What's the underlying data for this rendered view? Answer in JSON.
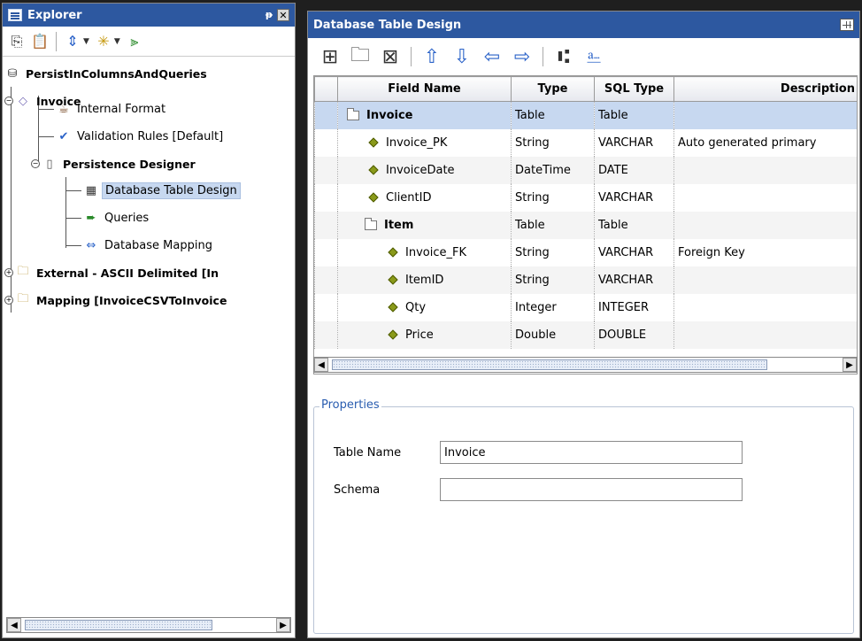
{
  "explorer": {
    "title": "Explorer",
    "pin": "ᵽ",
    "close": "✕",
    "toolbar": {
      "icons": [
        "copy-icon",
        "paste-icon",
        "sync-icon",
        "new-item-icon",
        "run-icon"
      ]
    },
    "tree": [
      {
        "label": "PersistInColumnsAndQueries",
        "icon": "database-icon"
      },
      {
        "label": "Invoice",
        "icon": "diamond-icon"
      },
      {
        "label": "Internal Format",
        "icon": "beans-icon"
      },
      {
        "label": "Validation Rules [Default]",
        "icon": "check-circle-icon"
      },
      {
        "label": "Persistence Designer",
        "icon": "cylinder-icon"
      },
      {
        "label": "Database Table Design",
        "icon": "table-icon"
      },
      {
        "label": "Queries",
        "icon": "query-arrow-icon"
      },
      {
        "label": "Database Mapping",
        "icon": "mapping-icon"
      },
      {
        "label": "External - ASCII Delimited [In",
        "icon": "folder-gear-icon"
      },
      {
        "label": "Mapping [InvoiceCSVToInvoice",
        "icon": "folder-gear-icon"
      }
    ]
  },
  "designer": {
    "title": "Database Table Design",
    "toolbar": {
      "icons": [
        "add-table-icon",
        "add-folder-icon",
        "delete-icon",
        "move-up-icon",
        "move-down-icon",
        "move-left-icon",
        "move-right-icon",
        "tree-icon",
        "import-icon"
      ]
    },
    "table": {
      "columns": [
        "Field Name",
        "Type",
        "SQL Type",
        "Description"
      ],
      "rows": [
        {
          "name": "Invoice",
          "type": "Table",
          "sql": "Table",
          "desc": ""
        },
        {
          "name": "Invoice_PK",
          "type": "String",
          "sql": "VARCHAR",
          "desc": "Auto generated primary"
        },
        {
          "name": "InvoiceDate",
          "type": "DateTime",
          "sql": "DATE",
          "desc": ""
        },
        {
          "name": "ClientID",
          "type": "String",
          "sql": "VARCHAR",
          "desc": ""
        },
        {
          "name": "Item",
          "type": "Table",
          "sql": "Table",
          "desc": ""
        },
        {
          "name": "Invoice_FK",
          "type": "String",
          "sql": "VARCHAR",
          "desc": "Foreign Key"
        },
        {
          "name": "ItemID",
          "type": "String",
          "sql": "VARCHAR",
          "desc": ""
        },
        {
          "name": "Qty",
          "type": "Integer",
          "sql": "INTEGER",
          "desc": ""
        },
        {
          "name": "Price",
          "type": "Double",
          "sql": "DOUBLE",
          "desc": ""
        }
      ]
    },
    "properties": {
      "legend": "Properties",
      "table_name_label": "Table Name",
      "table_name_value": "Invoice",
      "schema_label": "Schema",
      "schema_value": ""
    }
  }
}
